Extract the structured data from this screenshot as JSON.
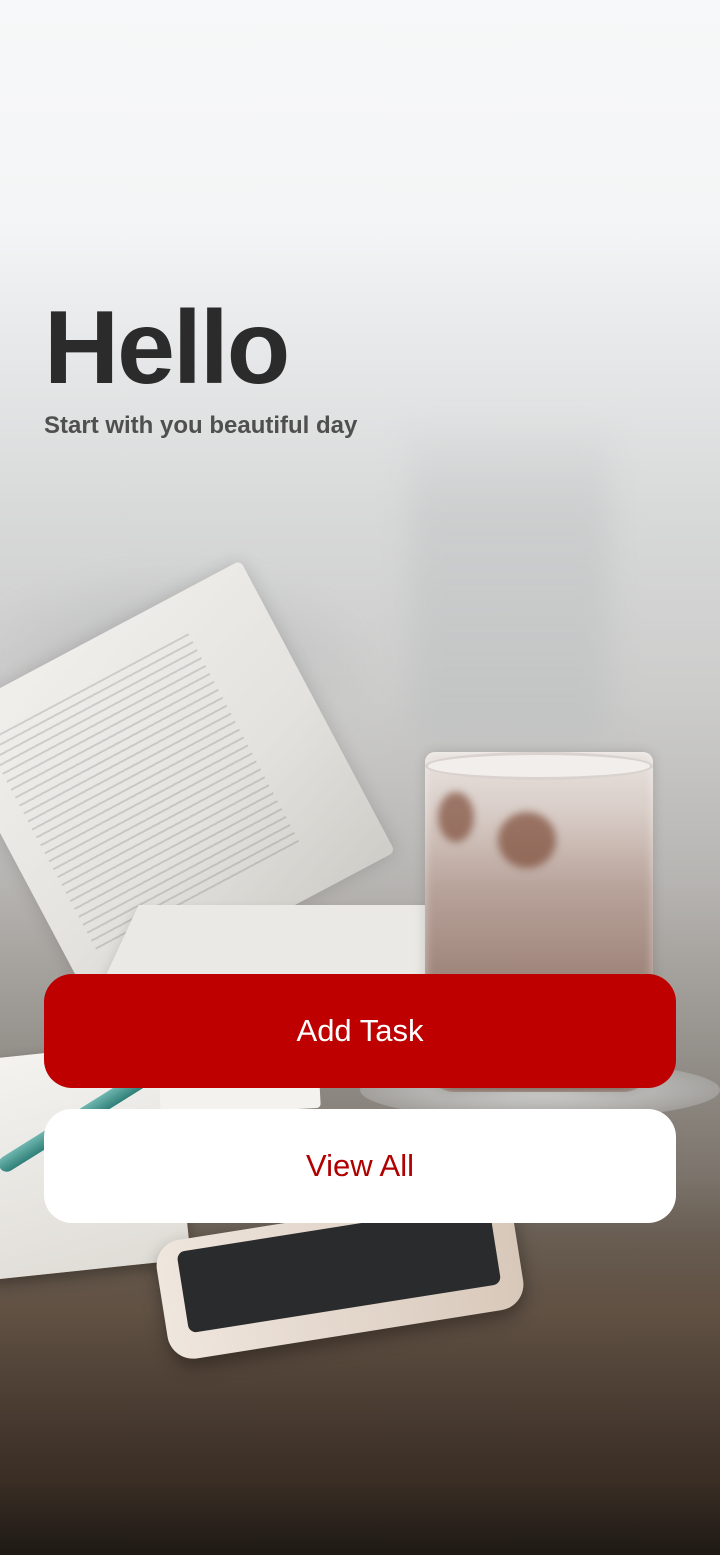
{
  "greeting": {
    "title": "Hello",
    "subtitle": "Start with you beautiful day"
  },
  "actions": {
    "add_task_label": "Add Task",
    "view_all_label": "View All"
  },
  "colors": {
    "primary_button": "#be0000",
    "secondary_button_text": "#b00000",
    "title_text": "#2b2b2b",
    "subtitle_text": "#4f4f4f"
  }
}
